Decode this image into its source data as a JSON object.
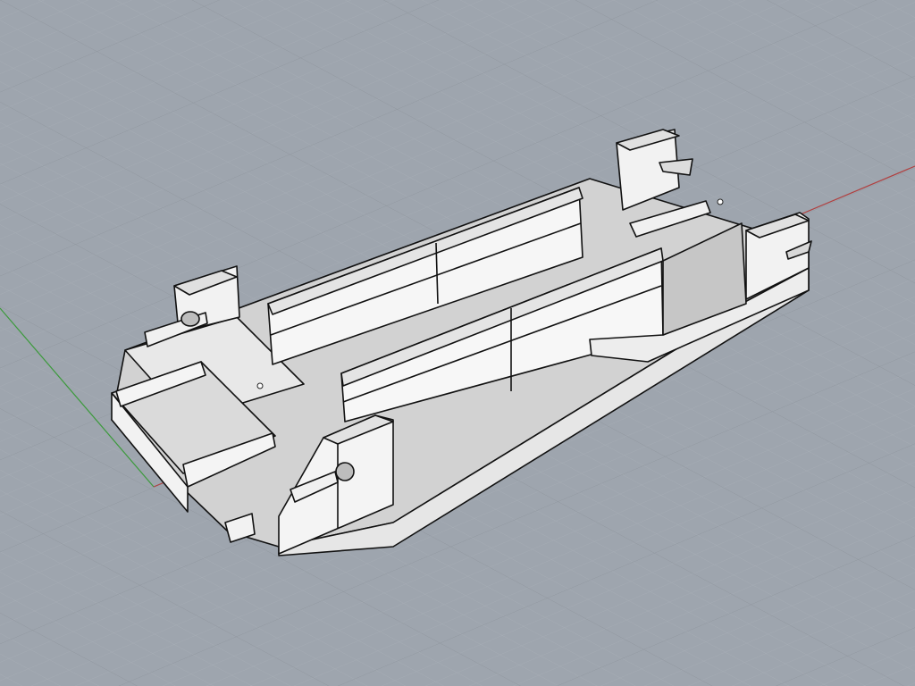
{
  "viewport": {
    "projection": "perspective",
    "background_color": "#9ea5ae",
    "grid_minor_color": "#a9b0b8",
    "grid_major_color": "#8d949c",
    "x_axis_color": "#b04040",
    "y_axis_color": "#3c9a3c",
    "model_face_color": "#f2f2f2",
    "model_shade_color": "#d6d6d6",
    "model_edge_color": "#111111"
  }
}
